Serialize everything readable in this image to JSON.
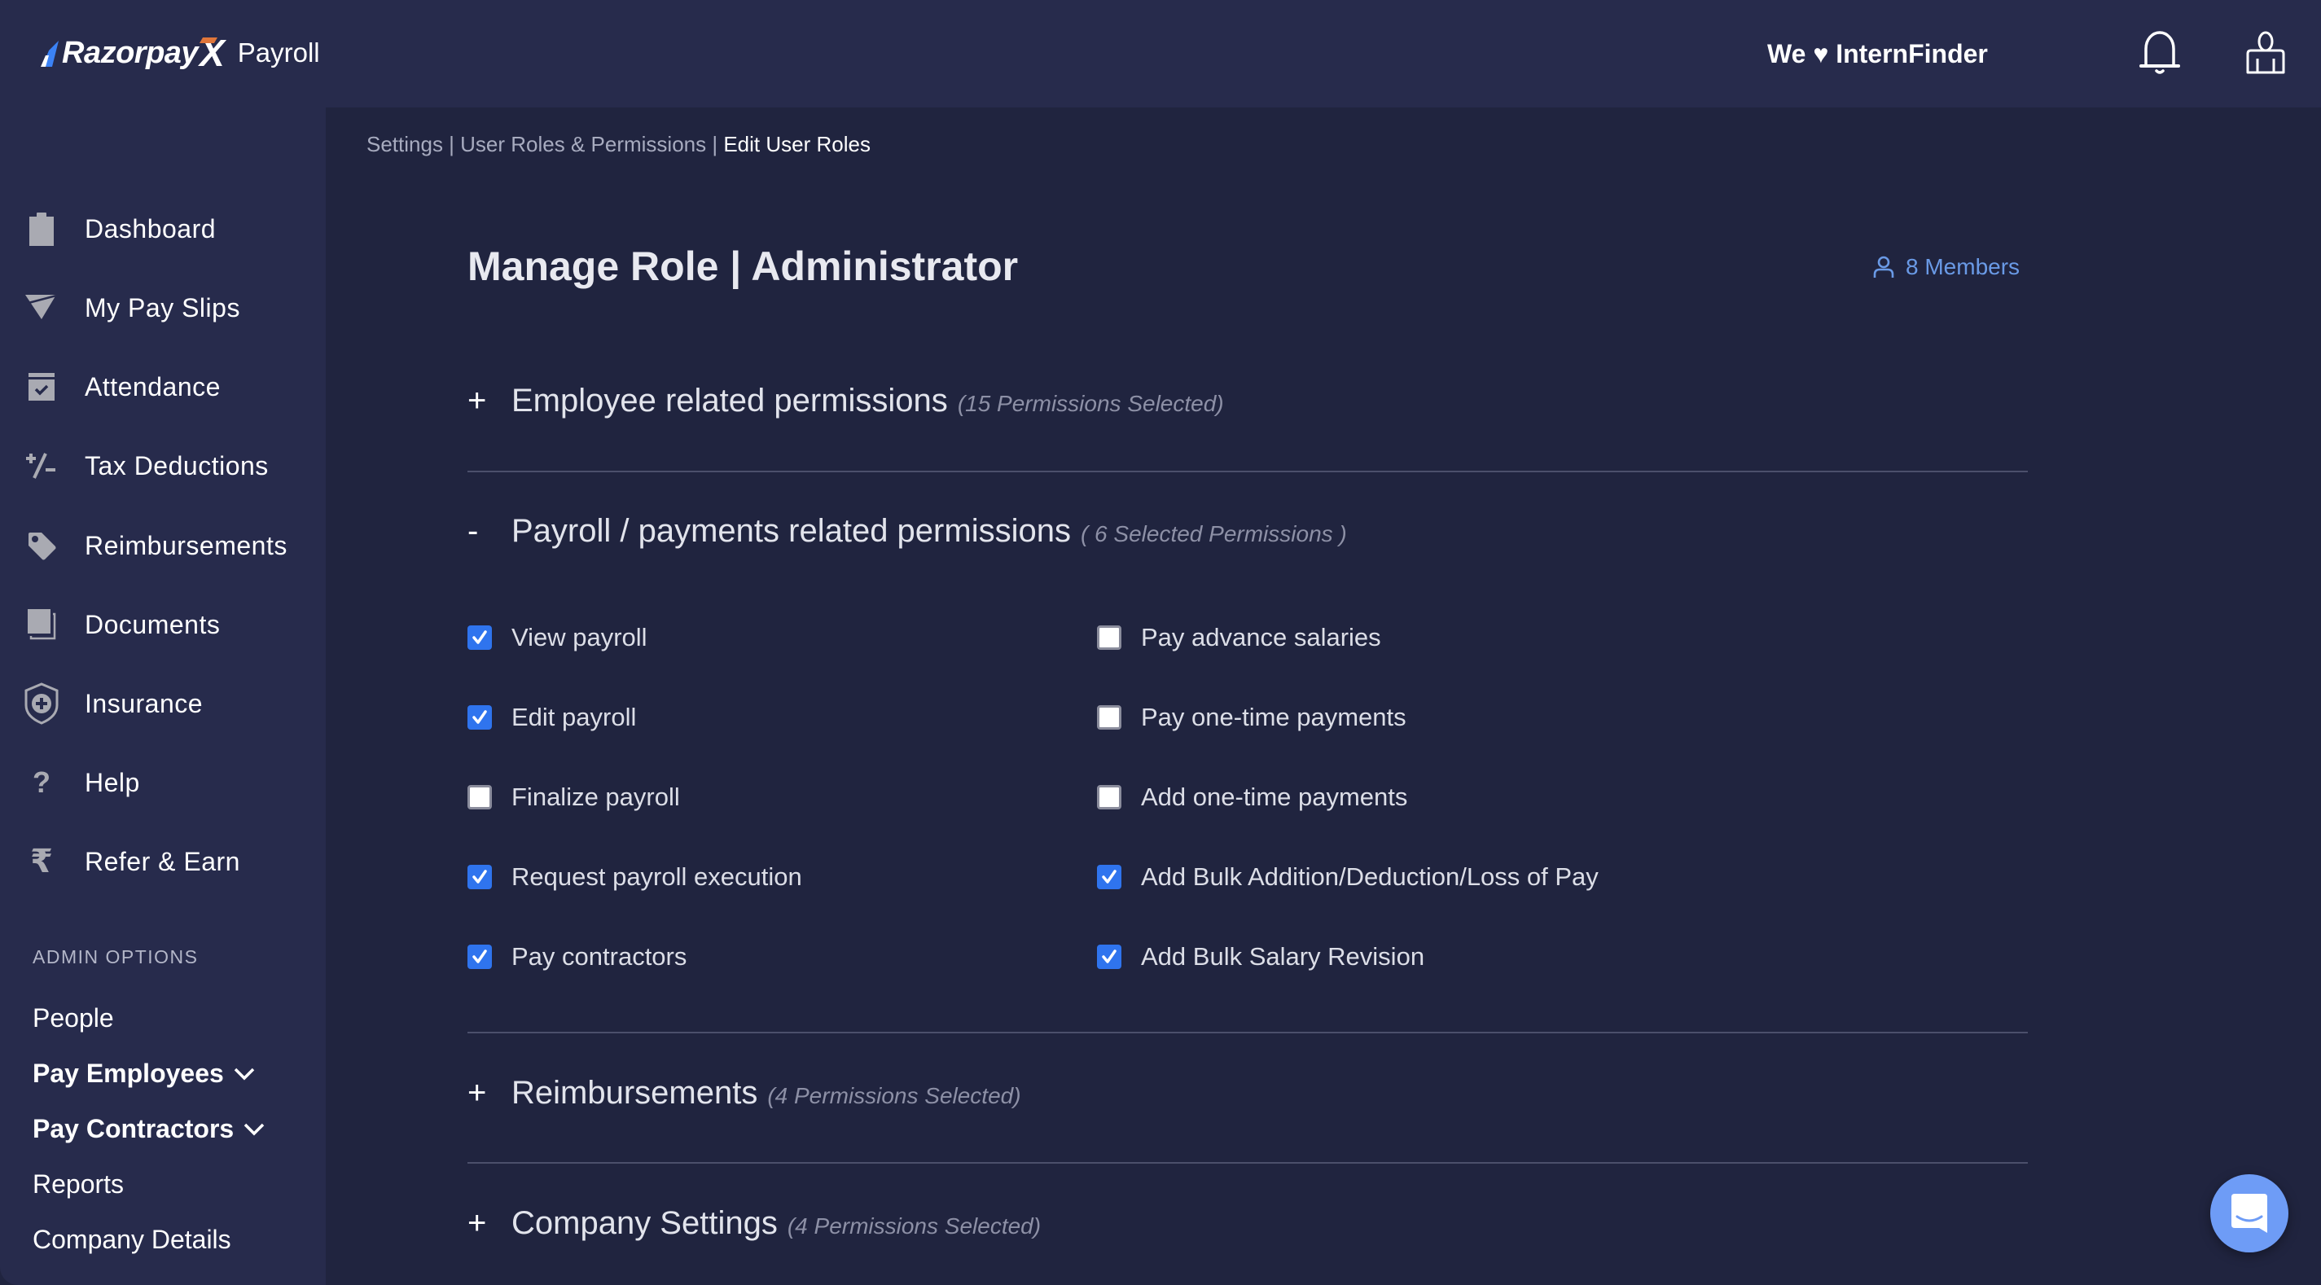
{
  "header": {
    "brand": "Razorpay",
    "brand_x": "X",
    "product": "Payroll",
    "company": "We ♥ InternFinder",
    "icons": [
      "bell-icon",
      "profile-icon"
    ]
  },
  "sidebar": {
    "items": [
      {
        "label": "Dashboard",
        "icon": "clipboard-icon"
      },
      {
        "label": "My Pay Slips",
        "icon": "paper-plane-icon"
      },
      {
        "label": "Attendance",
        "icon": "calendar-check-icon"
      },
      {
        "label": "Tax Deductions",
        "icon": "plus-minus-icon"
      },
      {
        "label": "Reimbursements",
        "icon": "tag-icon"
      },
      {
        "label": "Documents",
        "icon": "documents-icon"
      },
      {
        "label": "Insurance",
        "icon": "shield-plus-icon"
      },
      {
        "label": "Help",
        "icon": "question-icon"
      },
      {
        "label": "Refer & Earn",
        "icon": "rupee-icon"
      }
    ],
    "admin_title": "ADMIN OPTIONS",
    "admin_items": [
      {
        "label": "People",
        "expandable": false
      },
      {
        "label": "Pay Employees",
        "expandable": true
      },
      {
        "label": "Pay Contractors",
        "expandable": true
      },
      {
        "label": "Reports",
        "expandable": false
      },
      {
        "label": "Company Details",
        "expandable": false
      }
    ]
  },
  "breadcrumb": {
    "part1": "Settings | User Roles & Permissions | ",
    "current": "Edit User Roles"
  },
  "main": {
    "title": "Manage Role | Administrator",
    "members_label": "8 Members",
    "sections": [
      {
        "toggle": "+",
        "title": "Employee related permissions",
        "count": "(15 Permissions Selected)",
        "expanded": false
      },
      {
        "toggle": "-",
        "title": "Payroll / payments related permissions",
        "count": "( 6 Selected Permissions )",
        "expanded": true
      },
      {
        "toggle": "+",
        "title": "Reimbursements",
        "count": "(4 Permissions Selected)",
        "expanded": false
      },
      {
        "toggle": "+",
        "title": "Company Settings",
        "count": "(4 Permissions Selected)",
        "expanded": false
      }
    ],
    "permissions_left": [
      {
        "label": "View payroll",
        "checked": true
      },
      {
        "label": "Edit payroll",
        "checked": true
      },
      {
        "label": "Finalize payroll",
        "checked": false
      },
      {
        "label": "Request payroll execution",
        "checked": true
      },
      {
        "label": "Pay contractors",
        "checked": true
      }
    ],
    "permissions_right": [
      {
        "label": "Pay advance salaries",
        "checked": false
      },
      {
        "label": "Pay one-time payments",
        "checked": false
      },
      {
        "label": "Add one-time payments",
        "checked": false
      },
      {
        "label": "Add Bulk Addition/Deduction/Loss of Pay",
        "checked": true
      },
      {
        "label": "Add Bulk Salary Revision",
        "checked": true
      }
    ]
  },
  "colors": {
    "background": "#20243f",
    "panel": "#272b4c",
    "accent_blue": "#2f74ee",
    "link_blue": "#6a9ae6",
    "chat_blue": "#6e9cf6",
    "brand_orange": "#e0763a"
  }
}
